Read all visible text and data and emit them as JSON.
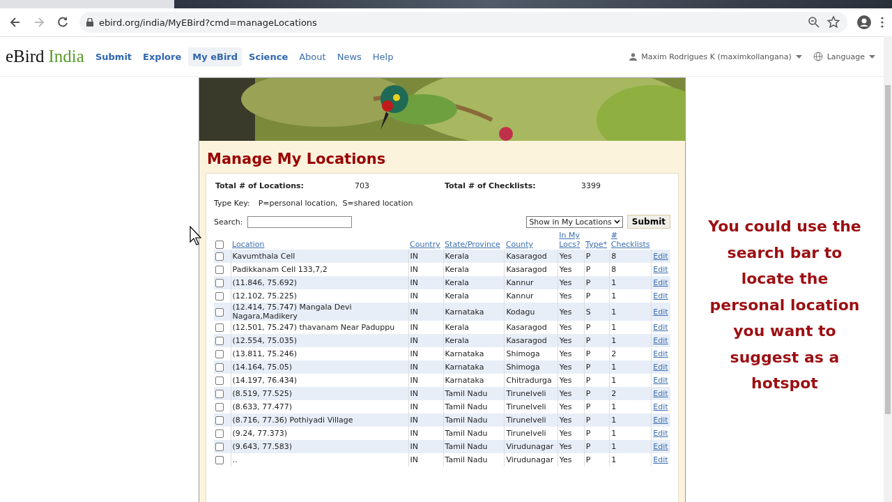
{
  "browser": {
    "url": "ebird.org/india/MyEBird?cmd=manageLocations"
  },
  "site_nav": {
    "logo": {
      "part_1": "eBird",
      "part_2": "India"
    },
    "items": [
      {
        "label": "Submit",
        "selected": false,
        "kind": "primary"
      },
      {
        "label": "Explore",
        "selected": false,
        "kind": "primary"
      },
      {
        "label": "My eBird",
        "selected": true,
        "kind": "primary"
      },
      {
        "label": "Science",
        "selected": false,
        "kind": "primary"
      },
      {
        "label": "About",
        "selected": false,
        "kind": "secondary"
      },
      {
        "label": "News",
        "selected": false,
        "kind": "secondary"
      },
      {
        "label": "Help",
        "selected": false,
        "kind": "secondary"
      }
    ],
    "user": "Maxim Rodrigues K (maximkollangana)",
    "language": "Language"
  },
  "page": {
    "title": "Manage My Locations",
    "totals": [
      {
        "label": "Total # of Locations:",
        "value": "703"
      },
      {
        "label": "Total # of Checklists:",
        "value": "3399"
      }
    ],
    "type_key": {
      "label": "Type Key:",
      "text": "P=personal location,  S=shared location"
    },
    "search": {
      "label": "Search:"
    },
    "action_select": "Show in My Locations",
    "submit": "Submit",
    "table": {
      "columns": [
        {
          "label": "Location"
        },
        {
          "label": "Country"
        },
        {
          "label": "State/Province"
        },
        {
          "label": "County"
        },
        {
          "label": "In My Locs?"
        },
        {
          "label": "Type*"
        },
        {
          "label": "# Checklists"
        }
      ],
      "select_all_checked": false,
      "rows": [
        {
          "checked": false,
          "cells": [
            "Kavumthala Cell",
            "IN",
            "Kerala",
            "Kasaragod",
            "Yes",
            "P",
            "8"
          ],
          "action": "Edit"
        },
        {
          "checked": false,
          "cells": [
            "Padikkanam Cell 133,7,2",
            "IN",
            "Kerala",
            "Kasaragod",
            "Yes",
            "P",
            "8"
          ],
          "action": "Edit"
        },
        {
          "checked": false,
          "cells": [
            "(11.846, 75.692)",
            "IN",
            "Kerala",
            "Kannur",
            "Yes",
            "P",
            "1"
          ],
          "action": "Edit"
        },
        {
          "checked": false,
          "cells": [
            "(12.102, 75.225)",
            "IN",
            "Kerala",
            "Kannur",
            "Yes",
            "P",
            "1"
          ],
          "action": "Edit"
        },
        {
          "checked": false,
          "cells": [
            "(12.414, 75.747) Mangala Devi Nagara,Madikery",
            "IN",
            "Karnataka",
            "Kodagu",
            "Yes",
            "S",
            "1"
          ],
          "action": "Edit"
        },
        {
          "checked": false,
          "cells": [
            "(12.501, 75.247) thavanam Near Paduppu",
            "IN",
            "Kerala",
            "Kasaragod",
            "Yes",
            "P",
            "1"
          ],
          "action": "Edit"
        },
        {
          "checked": false,
          "cells": [
            "(12.554, 75.035)",
            "IN",
            "Kerala",
            "Kasaragod",
            "Yes",
            "P",
            "1"
          ],
          "action": "Edit"
        },
        {
          "checked": false,
          "cells": [
            "(13.811, 75.246)",
            "IN",
            "Karnataka",
            "Shimoga",
            "Yes",
            "P",
            "2"
          ],
          "action": "Edit"
        },
        {
          "checked": false,
          "cells": [
            "(14.164, 75.05)",
            "IN",
            "Karnataka",
            "Shimoga",
            "Yes",
            "P",
            "1"
          ],
          "action": "Edit"
        },
        {
          "checked": false,
          "cells": [
            "(14.197, 76.434)",
            "IN",
            "Karnataka",
            "Chitradurga",
            "Yes",
            "P",
            "1"
          ],
          "action": "Edit"
        },
        {
          "checked": false,
          "cells": [
            "(8.519, 77.525)",
            "IN",
            "Tamil Nadu",
            "Tirunelveli",
            "Yes",
            "P",
            "2"
          ],
          "action": "Edit"
        },
        {
          "checked": false,
          "cells": [
            "(8.633, 77.477)",
            "IN",
            "Tamil Nadu",
            "Tirunelveli",
            "Yes",
            "P",
            "1"
          ],
          "action": "Edit"
        },
        {
          "checked": false,
          "cells": [
            "(8.716, 77.36) Pothiyadi Village",
            "IN",
            "Tamil Nadu",
            "Tirunelveli",
            "Yes",
            "P",
            "1"
          ],
          "action": "Edit"
        },
        {
          "checked": false,
          "cells": [
            "(9.24, 77.373)",
            "IN",
            "Tamil Nadu",
            "Tirunelveli",
            "Yes",
            "P",
            "1"
          ],
          "action": "Edit"
        },
        {
          "checked": false,
          "cells": [
            "(9.643, 77.583)",
            "IN",
            "Tamil Nadu",
            "Virudunagar",
            "Yes",
            "P",
            "1"
          ],
          "action": "Edit"
        },
        {
          "checked": false,
          "cells": [
            "..",
            "IN",
            "Tamil Nadu",
            "Virudunagar",
            "Yes",
            "P",
            "1"
          ],
          "action": "Edit"
        }
      ]
    }
  },
  "caption": "You could use the search bar to locate the personal location you want to suggest as a hotspot"
}
